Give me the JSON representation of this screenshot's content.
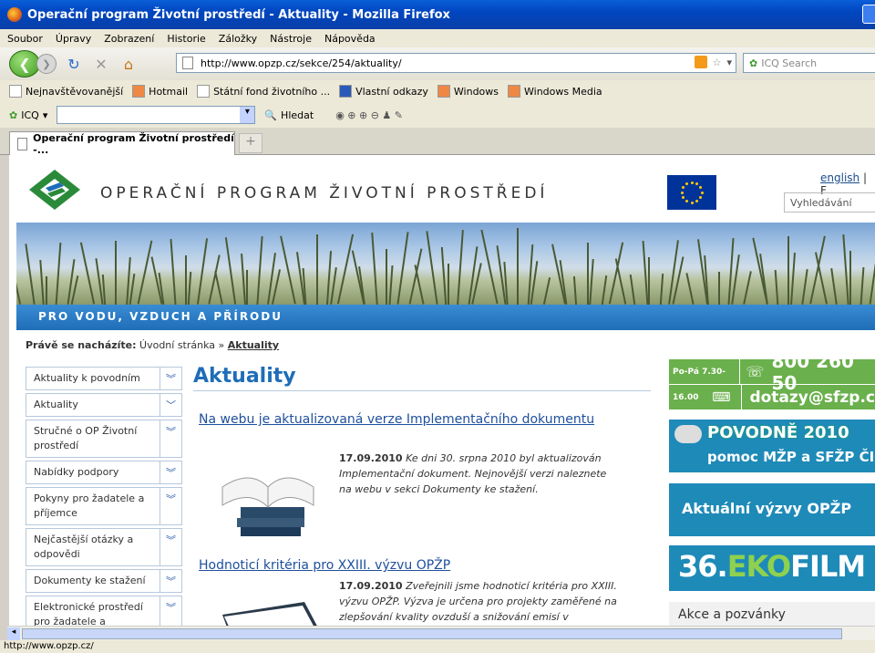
{
  "window": {
    "title": "Operační program Životní prostředí - Aktuality - Mozilla Firefox"
  },
  "menu": [
    "Soubor",
    "Úpravy",
    "Zobrazení",
    "Historie",
    "Záložky",
    "Nástroje",
    "Nápověda"
  ],
  "navbar": {
    "url": "http://www.opzp.cz/sekce/254/aktuality/",
    "search_placeholder": "ICQ Search"
  },
  "bookmarks": [
    "Nejnavštěvovanější",
    "Hotmail",
    "Státní fond životního ...",
    "Vlastní odkazy",
    "Windows",
    "Windows Media"
  ],
  "icqbar": {
    "label": "ICQ",
    "search_label": "Hledat"
  },
  "tab": {
    "label": "Operační program Životní prostředí -..."
  },
  "status": {
    "text": "http://www.opzp.cz/"
  },
  "site": {
    "logo_text": "OPERAČNÍ PROGRAM ŽIVOTNÍ PROSTŘEDÍ",
    "lang_english": "english",
    "lang_sep": "| F",
    "search_placeholder": "Vyhledávání",
    "slogan": "PRO VODU, VZDUCH A PŘÍRODU",
    "breadcrumb": {
      "prefix": "Právě se nacházíte:",
      "home": "Úvodní stránka",
      "sep": "»",
      "current": "Aktuality"
    },
    "sidenav": [
      "Aktuality k povodním",
      "Aktuality",
      "Stručné o OP Životní prostředí",
      "Nabídky podpory",
      "Pokyny pro žadatele a příjemce",
      "Nejčastější otázky a odpovědi",
      "Dokumenty ke stažení",
      "Elektronické prostředí pro žadatele a příjemce"
    ],
    "main_title": "Aktuality",
    "articles": [
      {
        "title": "Na webu je aktualizovaná verze Implementačního dokumentu",
        "date": "17.09.2010",
        "text": "Ke dni 30. srpna 2010 byl aktualizován Implementační dokument. Nejnovější verzi naleznete na webu v sekci Dokumenty ke stažení."
      },
      {
        "title": "Hodnoticí kritéria pro XXIII. výzvu OPŽP",
        "date": "17.09.2010",
        "text": "Zveřejnili jsme hodnoticí kritéria pro XXIII. výzvu OPŽP. Výzva je určena pro projekty zaměřené na zlepšování kvality ovzduší a snižování emisí v"
      }
    ],
    "right": {
      "phone_hours": "Po-Pá 7.30-16.00",
      "phone_number": "800 260 50",
      "email": "dotazy@sfzp.c",
      "flood_title": "POVODNĚ 2010",
      "flood_sub": "pomoc MŽP a SFŽP ČI",
      "calls": "Aktuální výzvy OPŽP",
      "eko_num": "36.",
      "eko_a": "EKO",
      "eko_b": "FILM",
      "akce": "Akce a pozvánky"
    }
  }
}
